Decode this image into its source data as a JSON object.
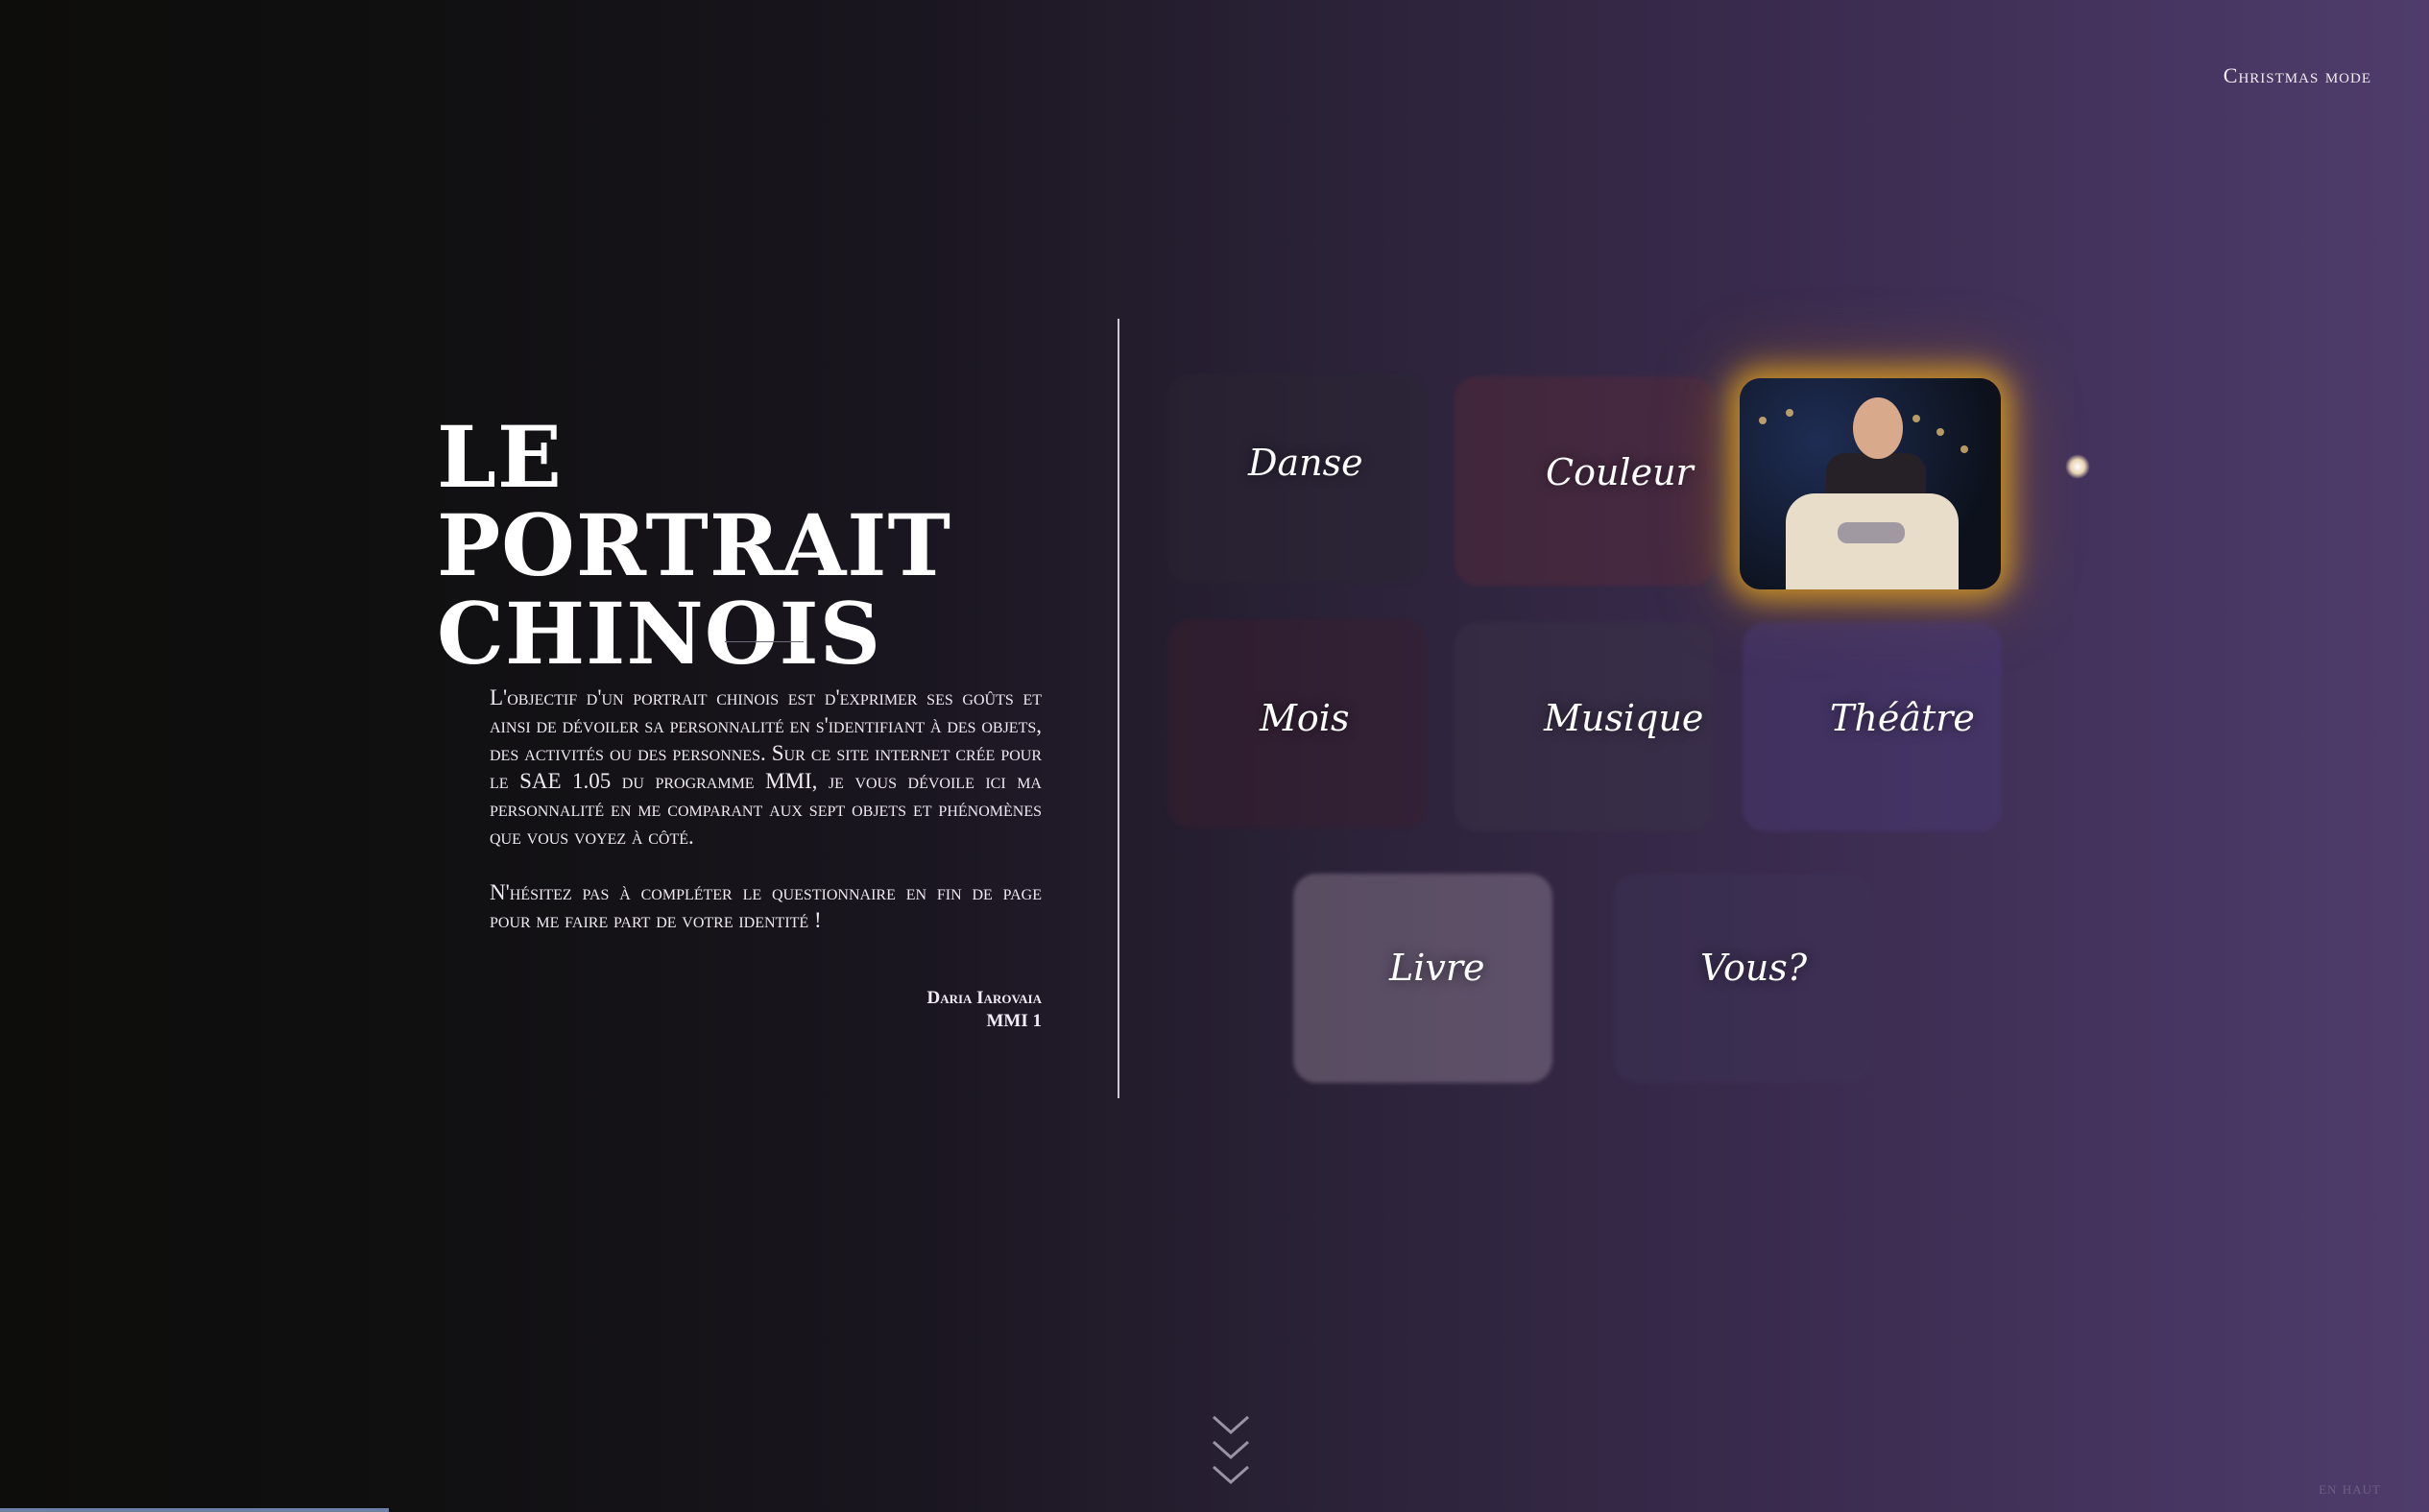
{
  "nav": {
    "mode_toggle": "Christmas mode"
  },
  "intro": {
    "title": "LE PORTRAIT CHINOIS",
    "paragraph1": "L'objectif d'un portrait chinois est d'exprimer ses goûts et ainsi de dévoiler sa personnalité en s'identifiant à des objets, des activités ou des personnes. Sur ce site internet crée pour le SAE 1.05 du programme MMI, je vous dévoile ici ma personnalité en me comparant aux sept objets et phénomènes que vous voyez à côté.",
    "paragraph2": "N'hésitez pas à compléter le questionnaire en fin de page pour me faire part de votre identité !",
    "signature_name": "Daria Iarovaia",
    "signature_class": "MMI 1"
  },
  "tiles": [
    {
      "label": "Danse",
      "color": "#2a2733"
    },
    {
      "label": "Couleur",
      "color": "#5b2b38"
    },
    {
      "label": "",
      "color": "#1f2332"
    },
    {
      "label": "Mois",
      "color": "#3b1e2e"
    },
    {
      "label": "Musique",
      "color": "#3c3448"
    },
    {
      "label": "Théâtre",
      "color": "#4b3b7a"
    },
    {
      "label": "Livre",
      "color": "#9a8a9f"
    },
    {
      "label": "Vous?",
      "color": "#3f3459"
    }
  ],
  "footer": {
    "back_to_top": "en haut"
  },
  "colors": {
    "accent_glow": "#edad1c",
    "divider": "#cfc8d8"
  }
}
